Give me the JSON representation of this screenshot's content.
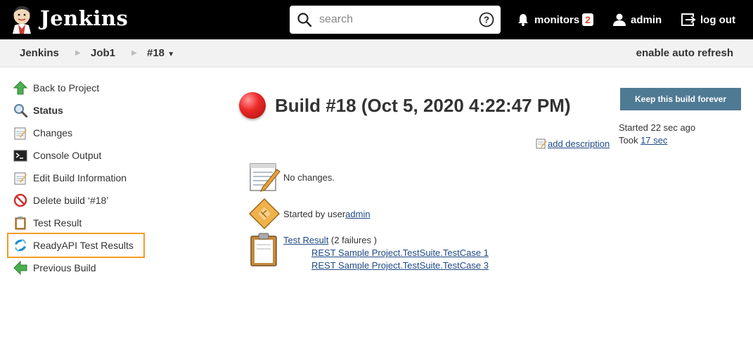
{
  "header": {
    "brand": "Jenkins",
    "search_placeholder": "search",
    "monitors_label": "monitors",
    "monitors_count": "2",
    "user": "admin",
    "logout": "log out"
  },
  "breadcrumb": {
    "items": [
      "Jenkins",
      "Job1",
      "#18"
    ],
    "auto_refresh": "enable auto refresh"
  },
  "sidebar": {
    "items": [
      {
        "label": "Back to Project",
        "icon": "up-arrow-icon"
      },
      {
        "label": "Status",
        "icon": "magnifier-icon"
      },
      {
        "label": "Changes",
        "icon": "notepad-icon"
      },
      {
        "label": "Console Output",
        "icon": "terminal-icon"
      },
      {
        "label": "Edit Build Information",
        "icon": "notepad-icon"
      },
      {
        "label": "Delete build ‘#18’",
        "icon": "no-entry-icon"
      },
      {
        "label": "Test Result",
        "icon": "clipboard-icon"
      },
      {
        "label": "ReadyAPI Test Results",
        "icon": "readyapi-icon"
      },
      {
        "label": "Previous Build",
        "icon": "left-arrow-icon"
      }
    ]
  },
  "build": {
    "title": "Build #18 (Oct 5, 2020 4:22:47 PM)",
    "status_color": "#ef2929",
    "keep_button": "Keep this build forever",
    "started_ago": "Started 22 sec ago",
    "took_prefix": "Took ",
    "took_value": "17 sec",
    "add_description": "add description",
    "no_changes": "No changes.",
    "started_by_prefix": "Started by user ",
    "started_by_user": "admin",
    "test_result_link": "Test Result",
    "test_result_suffix": " (2 failures )",
    "failed_tests": [
      "REST Sample Project.TestSuite.TestCase 1",
      "REST Sample Project.TestSuite.TestCase 3"
    ]
  },
  "colors": {
    "header_bg": "#000000",
    "breadcrumb_bg": "#f2f2f2",
    "link": "#204a87",
    "keep_button_bg": "#4f7a94",
    "highlight": "#f39c23",
    "badge_text": "#d24939"
  }
}
